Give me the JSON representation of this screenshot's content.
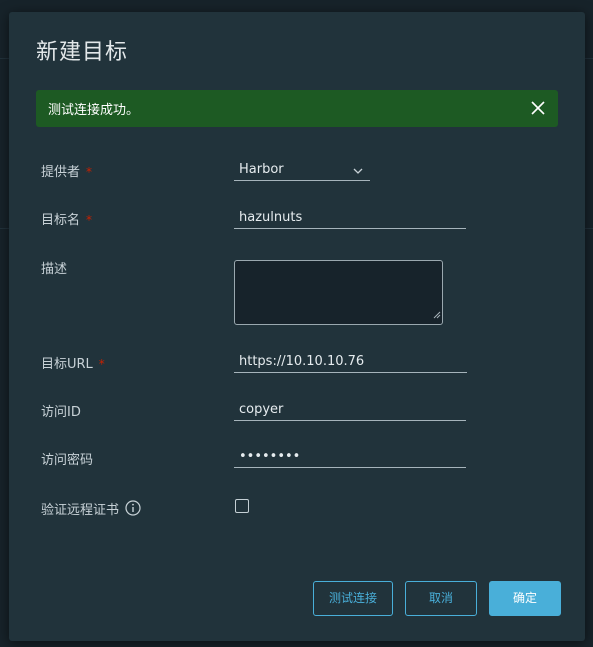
{
  "dialog": {
    "title": "新建目标"
  },
  "alert": {
    "message": "测试连接成功。",
    "close_icon": "close-icon",
    "color": "#1d5a23"
  },
  "form": {
    "provider": {
      "label": "提供者",
      "required_mark": "*",
      "value": "Harbor"
    },
    "name": {
      "label": "目标名",
      "required_mark": "*",
      "value": "hazulnuts"
    },
    "description": {
      "label": "描述",
      "value": ""
    },
    "url": {
      "label": "目标URL",
      "required_mark": "*",
      "value": "https://10.10.10.76"
    },
    "access_id": {
      "label": "访问ID",
      "value": "copyer"
    },
    "access_secret": {
      "label": "访问密码",
      "value": "••••••••"
    },
    "verify_cert": {
      "label": "验证远程证书",
      "checked": false,
      "icon": "info-icon"
    }
  },
  "footer": {
    "test_button": "测试连接",
    "cancel_button": "取消",
    "ok_button": "确定"
  },
  "colors": {
    "accent": "#49afd9",
    "required": "#c92100",
    "modal_bg": "#21333b"
  }
}
